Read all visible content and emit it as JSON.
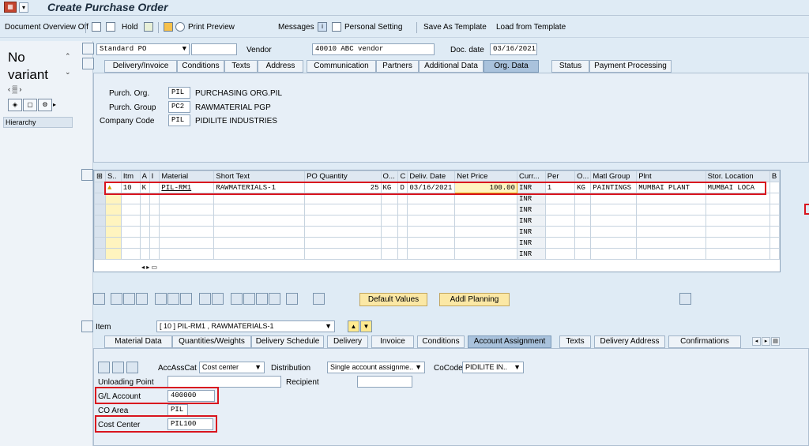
{
  "title": "Create Purchase Order",
  "toolbar": {
    "doc_overview": "Document Overview Off",
    "hold": "Hold",
    "print_preview": "Print Preview",
    "messages": "Messages",
    "personal_setting": "Personal Setting",
    "save_template": "Save As Template",
    "load_template": "Load from Template"
  },
  "leftnav": {
    "no_variant": "No variant",
    "hierarchy": "Hierarchy"
  },
  "header": {
    "doc_type": "Standard PO",
    "vendor_label": "Vendor",
    "vendor_value": "40010 ABC vendor",
    "doc_date_label": "Doc. date",
    "doc_date_value": "03/16/2021",
    "tabs": [
      "Delivery/Invoice",
      "Conditions",
      "Texts",
      "Address",
      "Communication",
      "Partners",
      "Additional Data",
      "Org. Data",
      "Status",
      "Payment Processing"
    ],
    "org": {
      "porg_label": "Purch. Org.",
      "porg_code": "PIL",
      "porg_name": "PURCHASING ORG.PIL",
      "pgrp_label": "Purch. Group",
      "pgrp_code": "PC2",
      "pgrp_name": "RAWMATERIAL PGP",
      "cc_label": "Company Code",
      "cc_code": "PIL",
      "cc_name": "PIDILITE INDUSTRIES"
    }
  },
  "items_table": {
    "columns": [
      "S..",
      "Itm",
      "A",
      "I",
      "Material",
      "Short Text",
      "PO Quantity",
      "O...",
      "C",
      "Deliv. Date",
      "Net Price",
      "Curr...",
      "Per",
      "O...",
      "Matl Group",
      "Plnt",
      "Stor. Location",
      "B"
    ],
    "row1": {
      "itm": "10",
      "a": "K",
      "material": "PIL-RM1",
      "short_text": "RAWMATERIALS-1",
      "qty": "25",
      "unit": "KG",
      "c": "D",
      "deliv_date": "03/16/2021",
      "net_price": "100.00",
      "curr": "INR",
      "per": "1",
      "o": "KG",
      "matl_group": "PAINTINGS",
      "plnt": "MUMBAI PLANT",
      "stor_loc": "MUMBAI LOCA"
    },
    "empty_curr": "INR"
  },
  "buttons": {
    "default_values": "Default Values",
    "addl_planning": "Addl Planning"
  },
  "item_detail": {
    "item_label": "Item",
    "item_value": "[ 10 ] PIL-RM1 , RAWMATERIALS-1",
    "tabs": [
      "Material Data",
      "Quantities/Weights",
      "Delivery Schedule",
      "Delivery",
      "Invoice",
      "Conditions",
      "Account Assignment",
      "Texts",
      "Delivery Address",
      "Confirmations"
    ],
    "acc_ass_cat_label": "AccAssCat",
    "acc_ass_cat_value": "Cost center",
    "distribution_label": "Distribution",
    "distribution_value": "Single account assignme..",
    "cocode_label": "CoCode",
    "cocode_value": "PIDILITE IN..",
    "unloading_label": "Unloading Point",
    "recipient_label": "Recipient",
    "gl_label": "G/L Account",
    "gl_value": "400000",
    "coarea_label": "CO Area",
    "coarea_value": "PIL",
    "costcenter_label": "Cost Center",
    "costcenter_value": "PIL100"
  }
}
